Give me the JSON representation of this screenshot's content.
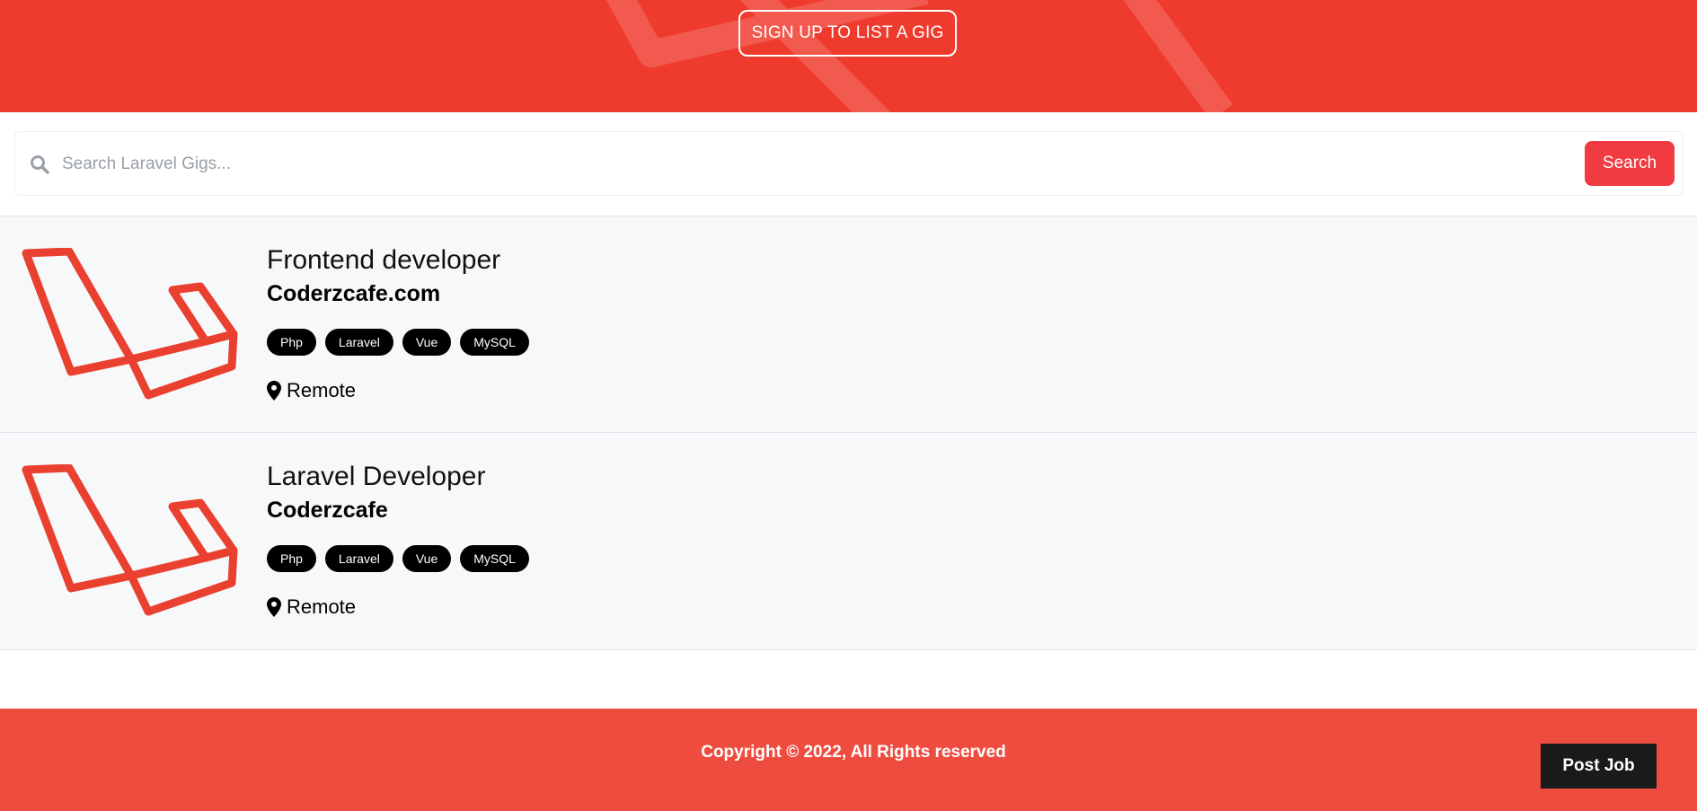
{
  "colors": {
    "brand": "#ef3b2d",
    "footer": "#ef4c40",
    "search_button": "#ef3b41",
    "tag_bg": "#000000"
  },
  "hero": {
    "cta_label": "SIGN UP TO LIST A GIG"
  },
  "search": {
    "placeholder": "Search Laravel Gigs...",
    "button_label": "Search",
    "icon": "search-icon"
  },
  "listings": [
    {
      "logo": "laravel-logo",
      "title": "Frontend developer",
      "company": "Coderzcafe.com",
      "tags": [
        "Php",
        "Laravel",
        "Vue",
        "MySQL"
      ],
      "location": "Remote"
    },
    {
      "logo": "laravel-logo",
      "title": "Laravel Developer",
      "company": "Coderzcafe",
      "tags": [
        "Php",
        "Laravel",
        "Vue",
        "MySQL"
      ],
      "location": "Remote"
    }
  ],
  "footer": {
    "copyright": "Copyright © 2022, All Rights reserved",
    "post_job_label": "Post Job"
  }
}
